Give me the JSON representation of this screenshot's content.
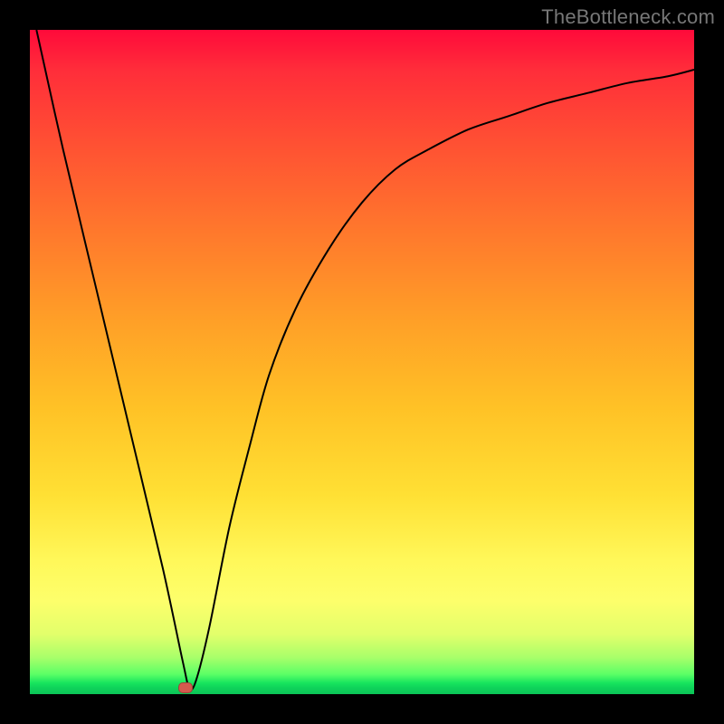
{
  "watermark": "TheBottleneck.com",
  "chart_data": {
    "type": "line",
    "title": "",
    "xlabel": "",
    "ylabel": "",
    "xlim": [
      0,
      100
    ],
    "ylim": [
      0,
      100
    ],
    "grid": false,
    "legend": false,
    "marker": {
      "x": 23.5,
      "y": 1
    },
    "series": [
      {
        "name": "curve",
        "x": [
          1,
          5,
          10,
          15,
          20,
          23,
          24,
          25,
          27,
          30,
          33,
          36,
          40,
          45,
          50,
          55,
          60,
          66,
          72,
          78,
          84,
          90,
          96,
          100
        ],
        "y": [
          100,
          82,
          61,
          40,
          19,
          5,
          1,
          2,
          10,
          25,
          37,
          48,
          58,
          67,
          74,
          79,
          82,
          85,
          87,
          89,
          90.5,
          92,
          93,
          94
        ]
      }
    ],
    "background_gradient": {
      "top": "#ff0a3a",
      "mid": "#ffe034",
      "bottom": "#0cc457"
    }
  }
}
